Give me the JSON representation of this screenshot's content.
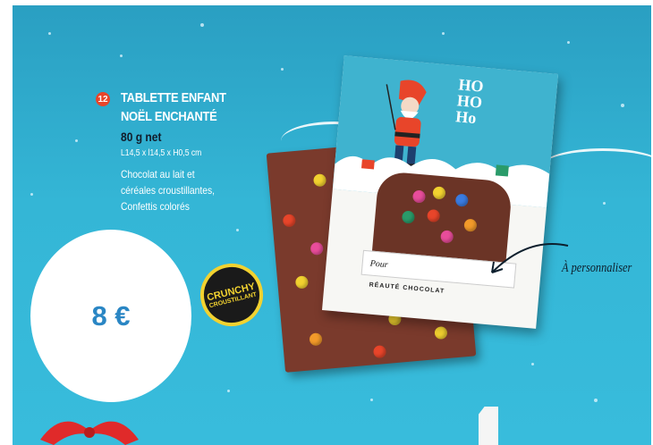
{
  "product": {
    "number": "12",
    "title_line1": "TABLETTE ENFANT",
    "title_line2": "NOËL ENCHANTÉ",
    "weight": "80 g net",
    "dimensions": "L14,5 x l14,5 x H0,5 cm",
    "description_line1": "Chocolat au lait et",
    "description_line2": "céréales croustillantes,",
    "description_line3": "Confettis colorés"
  },
  "price": "8 €",
  "badge": {
    "line1": "CRUNCHY",
    "line2": "CROUSTILLANT"
  },
  "packaging": {
    "hoho_line1": "HO",
    "hoho_line2": "HO",
    "hoho_line3": "Ho",
    "pour_label": "Pour",
    "brand": "RÉAUTÉ CHOCOLAT"
  },
  "personalize_label": "À personnaliser",
  "colors": {
    "background": "#34b6d6",
    "price_text": "#2a86c4",
    "chocolate": "#7a3a2c",
    "badge_yellow": "#f2d230",
    "number_badge": "#e8452a"
  }
}
